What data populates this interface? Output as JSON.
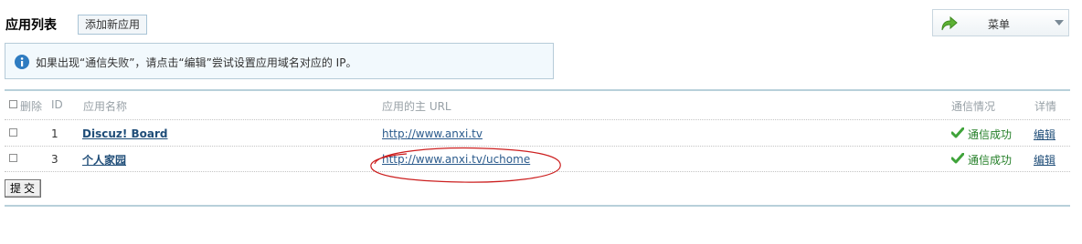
{
  "header": {
    "title": "应用列表",
    "add_button": "添加新应用",
    "menu_label": "菜单"
  },
  "notice": {
    "text": "如果出现“通信失败”，请点击“编辑”尝试设置应用域名对应的 IP。"
  },
  "table": {
    "columns": {
      "delete": "删除",
      "id": "ID",
      "name": "应用名称",
      "url": "应用的主 URL",
      "status": "通信情况",
      "detail": "详情"
    },
    "rows": [
      {
        "id": "1",
        "name": "Discuz! Board",
        "url": "http://www.anxi.tv",
        "status": "通信成功",
        "detail": "编辑"
      },
      {
        "id": "3",
        "name": "个人家园",
        "url": "http://www.anxi.tv/uchome",
        "status": "通信成功",
        "detail": "编辑"
      }
    ]
  },
  "submit_label": "提交",
  "colors": {
    "link": "#1f4d78",
    "success": "#26802a",
    "annotation": "#cc0000",
    "border": "#b8d0da"
  },
  "icons": {
    "menu": "green-forward-arrow-icon",
    "info": "info-icon",
    "status": "check-icon",
    "dropdown": "chevron-down-icon"
  }
}
